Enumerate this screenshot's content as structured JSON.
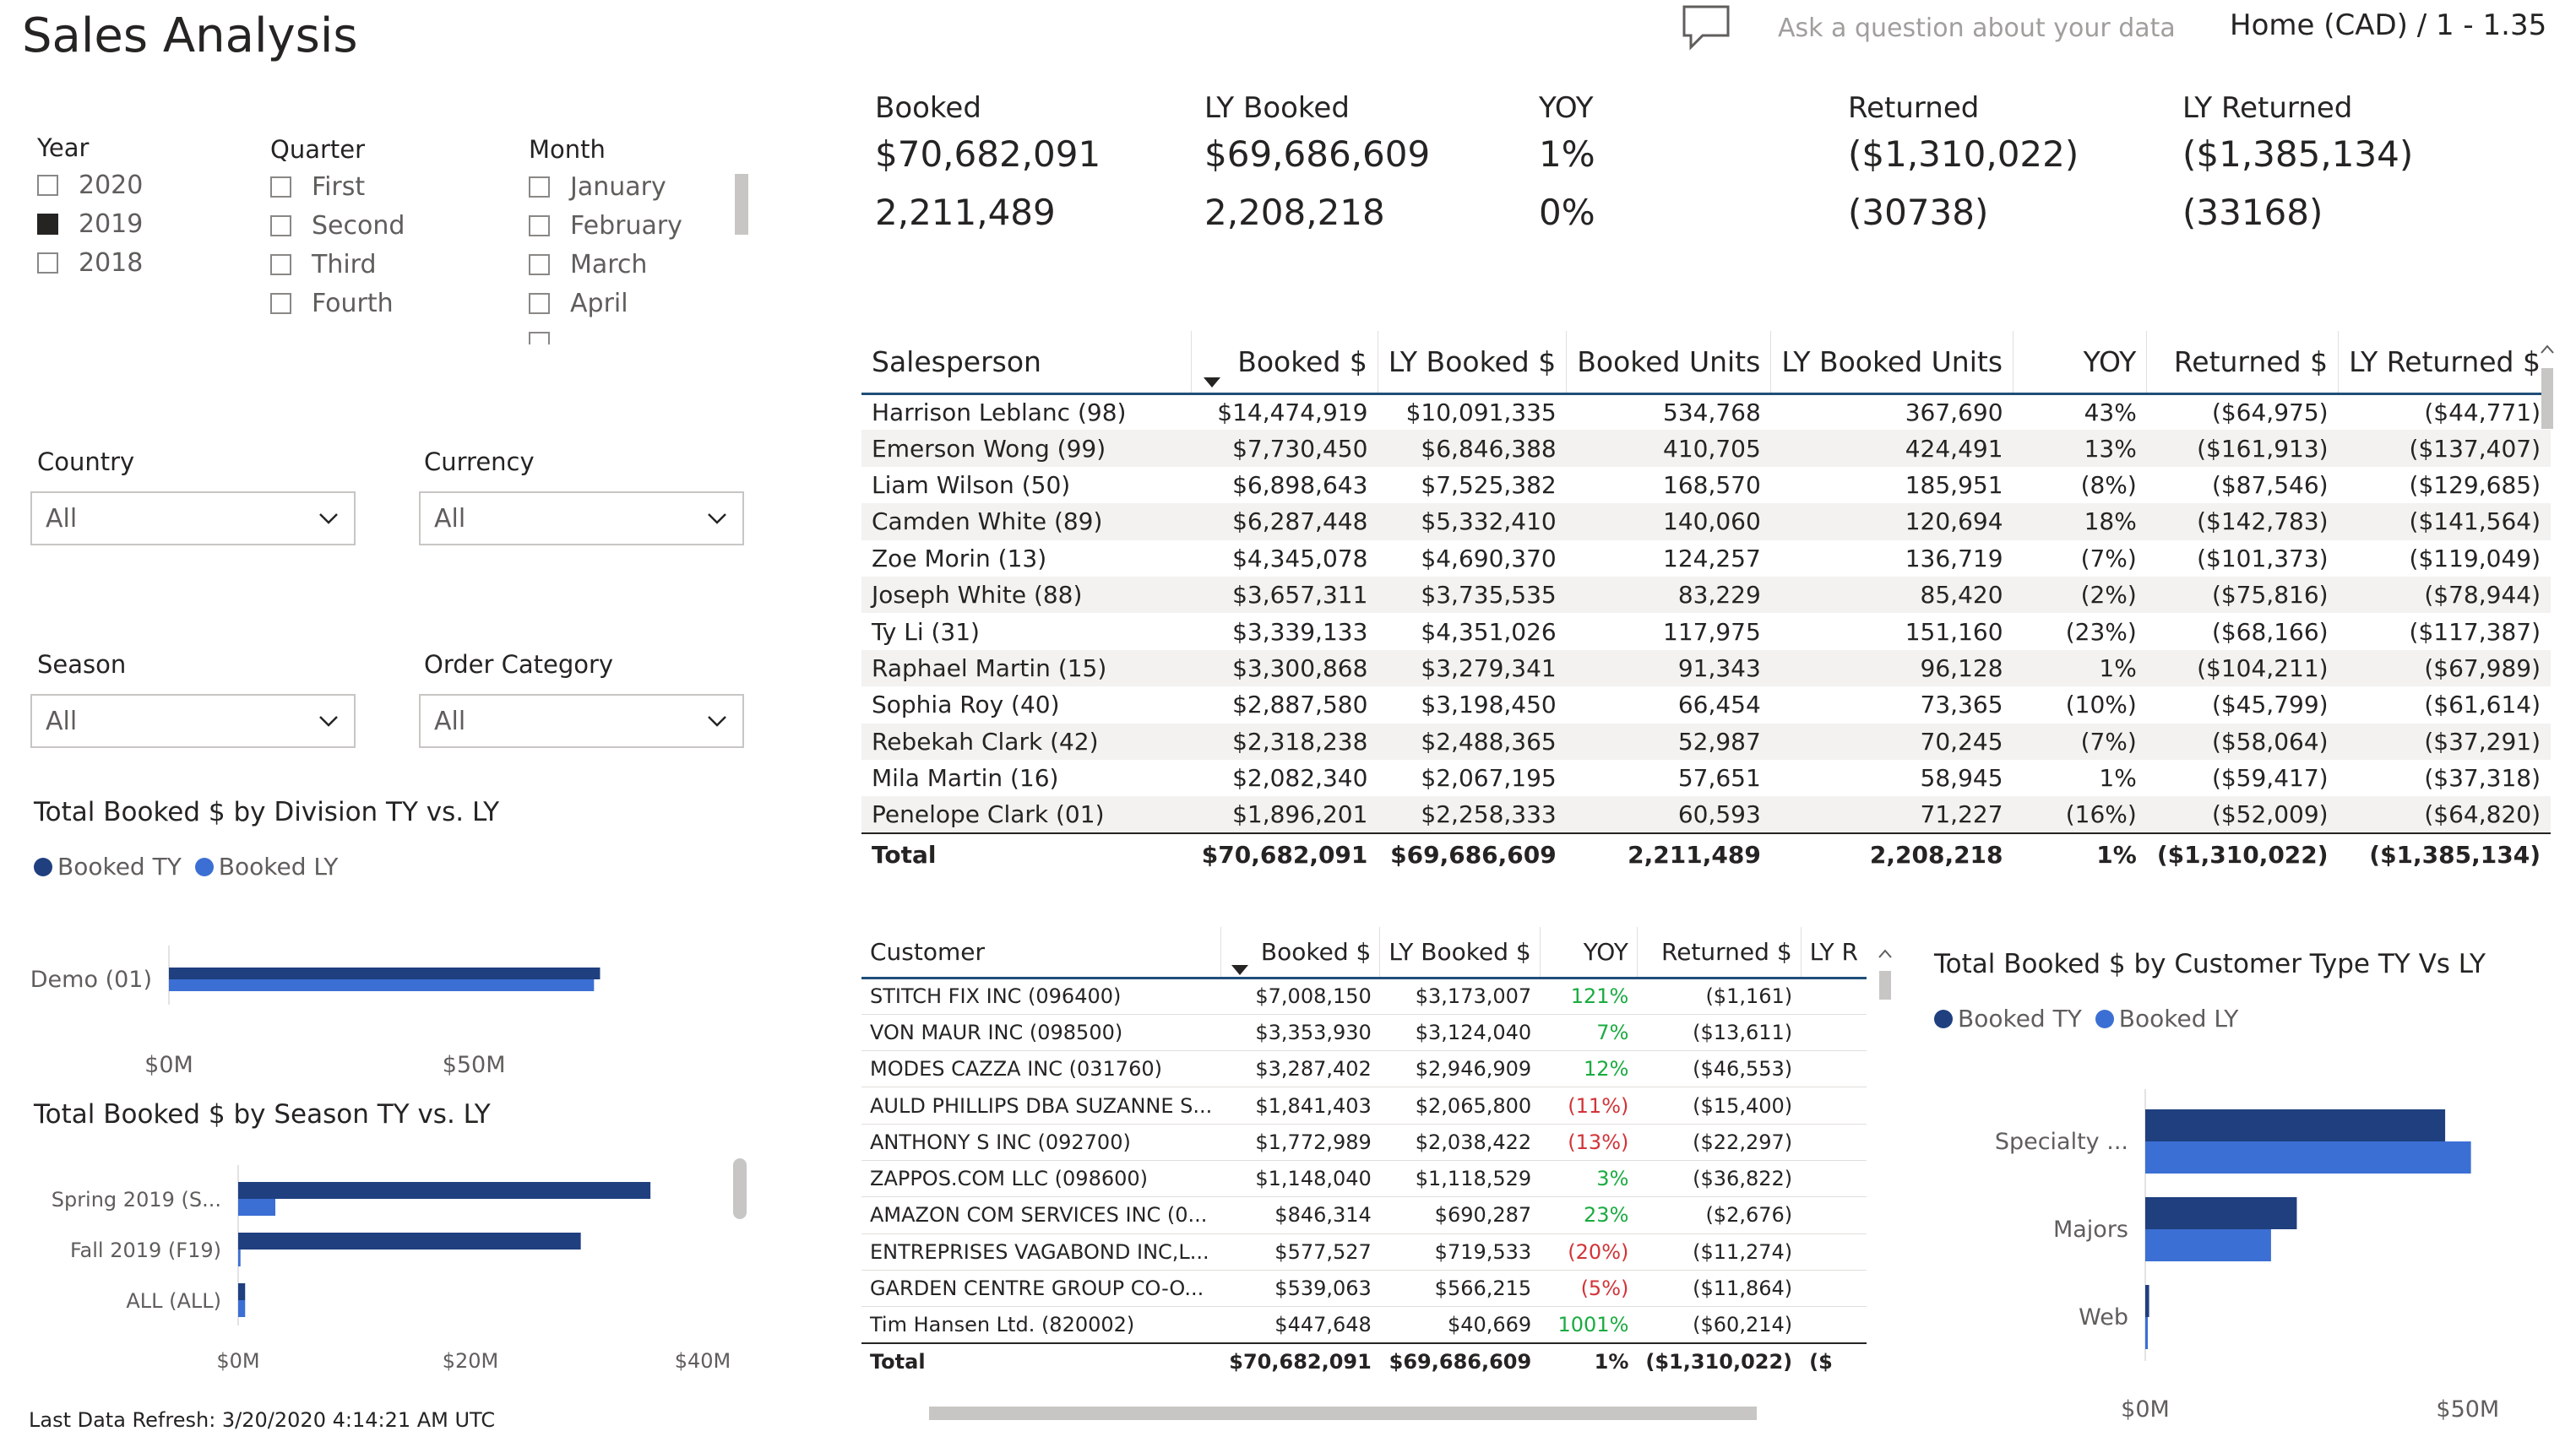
{
  "header": {
    "title": "Sales Analysis",
    "qa_placeholder": "Ask a question about your data",
    "breadcrumb": "Home (CAD) / 1 - 1.35"
  },
  "slicers": {
    "year": {
      "title": "Year",
      "items": [
        {
          "label": "2020",
          "checked": false
        },
        {
          "label": "2019",
          "checked": true
        },
        {
          "label": "2018",
          "checked": false
        }
      ]
    },
    "quarter": {
      "title": "Quarter",
      "items": [
        {
          "label": "First"
        },
        {
          "label": "Second"
        },
        {
          "label": "Third"
        },
        {
          "label": "Fourth"
        }
      ]
    },
    "month": {
      "title": "Month",
      "items": [
        {
          "label": "January"
        },
        {
          "label": "February"
        },
        {
          "label": "March"
        },
        {
          "label": "April"
        }
      ]
    },
    "country": {
      "title": "Country",
      "value": "All"
    },
    "currency": {
      "title": "Currency",
      "value": "All"
    },
    "season": {
      "title": "Season",
      "value": "All"
    },
    "order_category": {
      "title": "Order Category",
      "value": "All"
    }
  },
  "kpis": [
    {
      "label": "Booked",
      "value": "$70,682,091",
      "units": "2,211,489"
    },
    {
      "label": "LY Booked",
      "value": "$69,686,609",
      "units": "2,208,218"
    },
    {
      "label": "YOY",
      "value": "1%",
      "units": "0%"
    },
    {
      "label": "Returned",
      "value": "($1,310,022)",
      "units": "(30738)"
    },
    {
      "label": "LY Returned",
      "value": "($1,385,134)",
      "units": "(33168)"
    }
  ],
  "salesperson_table": {
    "columns": [
      "Salesperson",
      "Booked $",
      "LY Booked $",
      "Booked Units",
      "LY Booked Units",
      "YOY",
      "Returned $",
      "LY Returned $"
    ],
    "rows": [
      [
        "Harrison Leblanc (98)",
        "$14,474,919",
        "$10,091,335",
        "534,768",
        "367,690",
        "43%",
        "($64,975)",
        "($44,771)"
      ],
      [
        "Emerson Wong (99)",
        "$7,730,450",
        "$6,846,388",
        "410,705",
        "424,491",
        "13%",
        "($161,913)",
        "($137,407)"
      ],
      [
        "Liam Wilson (50)",
        "$6,898,643",
        "$7,525,382",
        "168,570",
        "185,951",
        "(8%)",
        "($87,546)",
        "($129,685)"
      ],
      [
        "Camden White (89)",
        "$6,287,448",
        "$5,332,410",
        "140,060",
        "120,694",
        "18%",
        "($142,783)",
        "($141,564)"
      ],
      [
        "Zoe Morin (13)",
        "$4,345,078",
        "$4,690,370",
        "124,257",
        "136,719",
        "(7%)",
        "($101,373)",
        "($119,049)"
      ],
      [
        "Joseph White (88)",
        "$3,657,311",
        "$3,735,535",
        "83,229",
        "85,420",
        "(2%)",
        "($75,816)",
        "($78,944)"
      ],
      [
        "Ty Li (31)",
        "$3,339,133",
        "$4,351,026",
        "117,975",
        "151,160",
        "(23%)",
        "($68,166)",
        "($117,387)"
      ],
      [
        "Raphael Martin (15)",
        "$3,300,868",
        "$3,279,341",
        "91,343",
        "96,128",
        "1%",
        "($104,211)",
        "($67,989)"
      ],
      [
        "Sophia Roy (40)",
        "$2,887,580",
        "$3,198,450",
        "66,454",
        "73,365",
        "(10%)",
        "($45,799)",
        "($61,614)"
      ],
      [
        "Rebekah Clark (42)",
        "$2,318,238",
        "$2,488,365",
        "52,987",
        "70,245",
        "(7%)",
        "($58,064)",
        "($37,291)"
      ],
      [
        "Mila Martin (16)",
        "$2,082,340",
        "$2,067,195",
        "57,651",
        "58,945",
        "1%",
        "($59,417)",
        "($37,318)"
      ],
      [
        "Penelope Clark (01)",
        "$1,896,201",
        "$2,258,333",
        "60,593",
        "71,227",
        "(16%)",
        "($52,009)",
        "($64,820)"
      ]
    ],
    "total": [
      "Total",
      "$70,682,091",
      "$69,686,609",
      "2,211,489",
      "2,208,218",
      "1%",
      "($1,310,022)",
      "($1,385,134)"
    ]
  },
  "customer_table": {
    "columns": [
      "Customer",
      "Booked $",
      "LY Booked $",
      "YOY",
      "Returned $",
      "LY R"
    ],
    "rows": [
      [
        "STITCH FIX INC (096400)",
        "$7,008,150",
        "$3,173,007",
        "121%",
        "($1,161)"
      ],
      [
        "VON MAUR INC (098500)",
        "$3,353,930",
        "$3,124,040",
        "7%",
        "($13,611)"
      ],
      [
        "MODES CAZZA INC (031760)",
        "$3,287,402",
        "$2,946,909",
        "12%",
        "($46,553)"
      ],
      [
        "AULD PHILLIPS DBA SUZANNE S...",
        "$1,841,403",
        "$2,065,800",
        "(11%)",
        "($15,400)"
      ],
      [
        "ANTHONY S INC (092700)",
        "$1,772,989",
        "$2,038,422",
        "(13%)",
        "($22,297)"
      ],
      [
        "ZAPPOS.COM LLC (098600)",
        "$1,148,040",
        "$1,118,529",
        "3%",
        "($36,822)"
      ],
      [
        "AMAZON COM SERVICES INC (0...",
        "$846,314",
        "$690,287",
        "23%",
        "($2,676)"
      ],
      [
        "ENTREPRISES VAGABOND INC,L...",
        "$577,527",
        "$719,533",
        "(20%)",
        "($11,274)"
      ],
      [
        "GARDEN CENTRE GROUP CO-O...",
        "$539,063",
        "$566,215",
        "(5%)",
        "($11,864)"
      ],
      [
        "Tim Hansen Ltd. (820002)",
        "$447,648",
        "$40,669",
        "1001%",
        "($60,214)"
      ]
    ],
    "total": [
      "Total",
      "$70,682,091",
      "$69,686,609",
      "1%",
      "($1,310,022)",
      "($"
    ]
  },
  "charts": {
    "colors": {
      "booked_ty": "#1f3f7f",
      "booked_ly": "#3b6fd4"
    },
    "legend": {
      "ty": "Booked TY",
      "ly": "Booked LY"
    }
  },
  "chart_data": [
    {
      "type": "bar",
      "orientation": "horizontal",
      "title": "Total Booked $ by Division TY vs. LY",
      "categories": [
        "Demo (01)"
      ],
      "series": [
        {
          "name": "Booked TY",
          "values": [
            70.68
          ]
        },
        {
          "name": "Booked LY",
          "values": [
            69.69
          ]
        }
      ],
      "xticks": [
        "$0M",
        "$50M"
      ],
      "xlim": [
        0,
        90
      ],
      "legend": "top-left"
    },
    {
      "type": "bar",
      "orientation": "horizontal",
      "title": "Total Booked $ by Season TY vs. LY",
      "categories": [
        "Spring 2019 (S...",
        "Fall 2019 (F19)",
        "ALL (ALL)"
      ],
      "series": [
        {
          "name": "Booked TY",
          "values": [
            35.5,
            29.5,
            0.6
          ]
        },
        {
          "name": "Booked LY",
          "values": [
            3.2,
            0.2,
            0.6
          ]
        }
      ],
      "xticks": [
        "$0M",
        "$20M",
        "$40M"
      ],
      "xlim": [
        0,
        40
      ]
    },
    {
      "type": "bar",
      "orientation": "horizontal",
      "title": "Total Booked $ by Customer Type TY Vs LY",
      "categories": [
        "Specialty ...",
        "Majors",
        "Web"
      ],
      "series": [
        {
          "name": "Booked TY",
          "values": [
            46.5,
            23.5,
            0.6
          ]
        },
        {
          "name": "Booked LY",
          "values": [
            50.5,
            19.5,
            0.4
          ]
        }
      ],
      "xticks": [
        "$0M",
        "$50M"
      ],
      "xlim": [
        0,
        55
      ],
      "legend": "top-left"
    }
  ],
  "footer": {
    "refresh": "Last Data Refresh: 3/20/2020 4:14:21 AM UTC"
  }
}
